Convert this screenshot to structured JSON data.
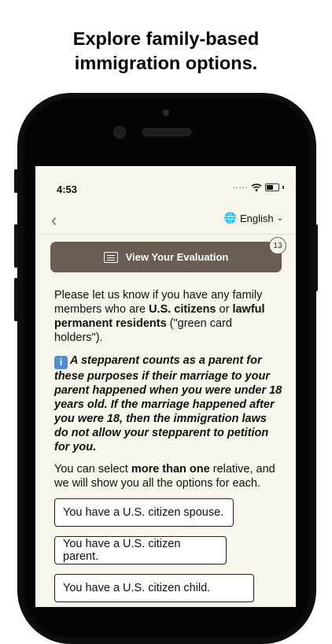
{
  "headline": {
    "line1": "Explore family-based",
    "line2": "immigration options."
  },
  "status_bar": {
    "time": "4:53",
    "dots": "•••••",
    "wifi_icon": "wifi-icon",
    "battery_icon": "battery-icon"
  },
  "nav": {
    "back_icon": "chevron-left-icon",
    "language": "English",
    "globe_icon": "globe-icon",
    "dropdown_icon": "chevron-down-icon"
  },
  "evaluation": {
    "label": "View Your Evaluation",
    "badge_count": "13",
    "icon": "document-list-icon"
  },
  "content": {
    "p1_a": "Please let us know if you have any family members who are ",
    "p1_b": "U.S. citizens",
    "p1_c": " or ",
    "p1_d": "lawful permanent residents",
    "p1_e": " (\"green card holders\").",
    "info_icon_glyph": "i",
    "p2": "A stepparent counts as a parent for these purposes if their marriage to your parent happened when you were under 18 years old. If the marriage happened after you were 18, then the immigration laws do not allow your stepparent to petition for you.",
    "p3_a": "You can select ",
    "p3_b": "more than one",
    "p3_c": " relative, and we will show you all the options for each."
  },
  "options": [
    {
      "label": "You have a U.S. citizen spouse."
    },
    {
      "label": "You have a U.S. citizen parent."
    },
    {
      "label": "You have a U.S. citizen child."
    }
  ],
  "colors": {
    "screen_bg": "#f9f5ea",
    "button_bg": "#6a5d51",
    "info_blue": "#4f8fd1"
  }
}
